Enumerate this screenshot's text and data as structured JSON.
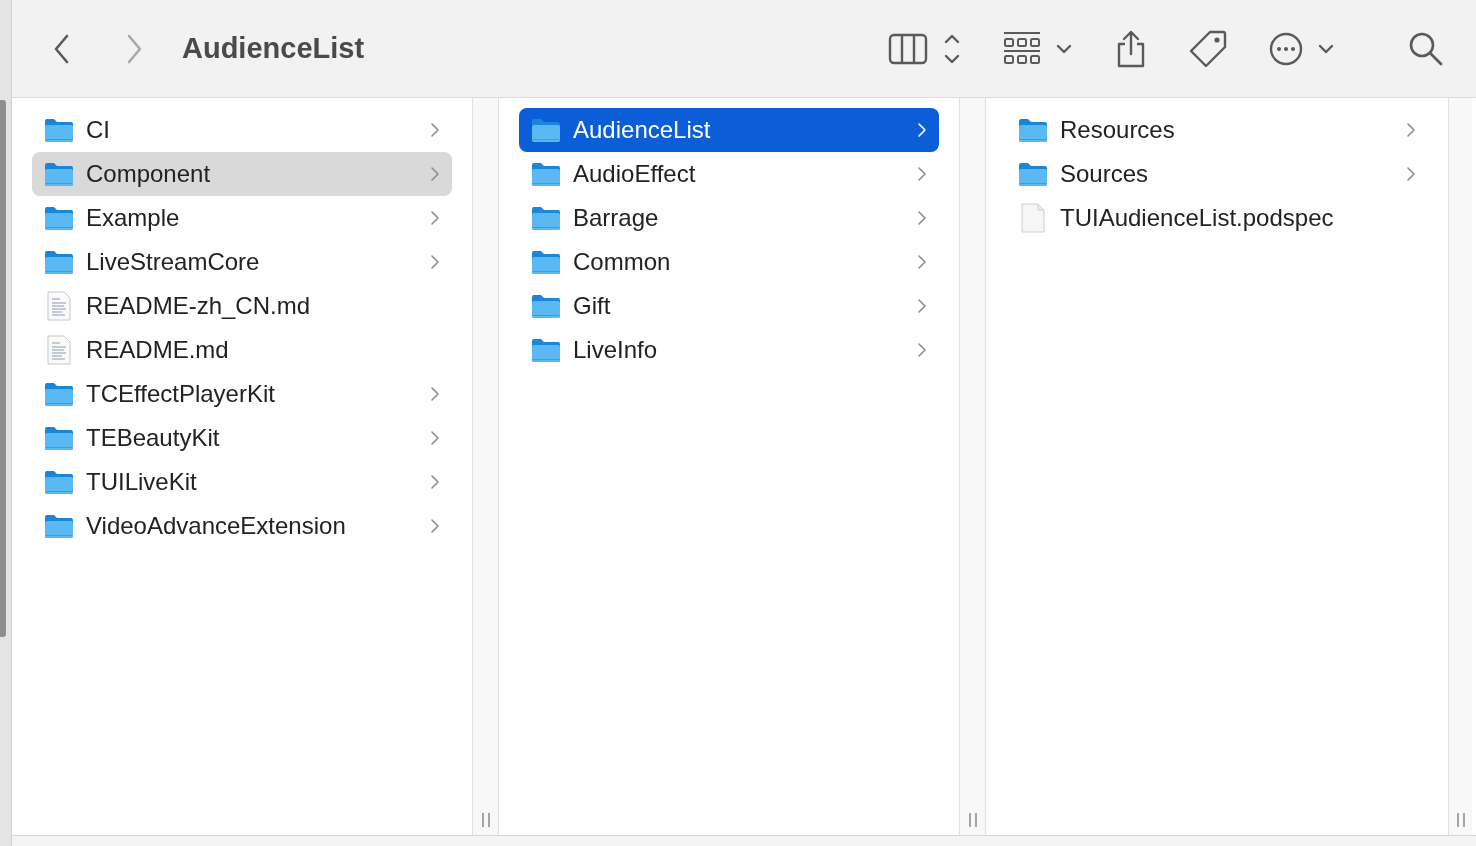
{
  "toolbar": {
    "navigation": [
      {
        "kind": "back",
        "disabled": false
      },
      {
        "kind": "forward",
        "disabled": true
      }
    ],
    "title": "AudienceList"
  },
  "columns": [
    {
      "focused": false,
      "items": [
        {
          "name": "CI",
          "kind": "folder",
          "selected": false
        },
        {
          "name": "Component",
          "kind": "folder",
          "selected": true
        },
        {
          "name": "Example",
          "kind": "folder",
          "selected": false
        },
        {
          "name": "LiveStreamCore",
          "kind": "folder",
          "selected": false
        },
        {
          "name": "README-zh_CN.md",
          "kind": "markdown",
          "selected": false
        },
        {
          "name": "README.md",
          "kind": "markdown",
          "selected": false
        },
        {
          "name": "TCEffectPlayerKit",
          "kind": "folder",
          "selected": false
        },
        {
          "name": "TEBeautyKit",
          "kind": "folder",
          "selected": false
        },
        {
          "name": "TUILiveKit",
          "kind": "folder",
          "selected": false
        },
        {
          "name": "VideoAdvanceExtension",
          "kind": "folder",
          "selected": false
        }
      ]
    },
    {
      "focused": true,
      "items": [
        {
          "name": "AudienceList",
          "kind": "folder",
          "selected": true
        },
        {
          "name": "AudioEffect",
          "kind": "folder",
          "selected": false
        },
        {
          "name": "Barrage",
          "kind": "folder",
          "selected": false
        },
        {
          "name": "Common",
          "kind": "folder",
          "selected": false
        },
        {
          "name": "Gift",
          "kind": "folder",
          "selected": false
        },
        {
          "name": "LiveInfo",
          "kind": "folder",
          "selected": false
        }
      ]
    },
    {
      "items": [
        {
          "name": "Resources",
          "kind": "folder",
          "selected": false
        },
        {
          "name": "Sources",
          "kind": "folder",
          "selected": false
        },
        {
          "name": "TUIAudienceList.podspec",
          "kind": "file",
          "selected": false
        }
      ]
    }
  ]
}
